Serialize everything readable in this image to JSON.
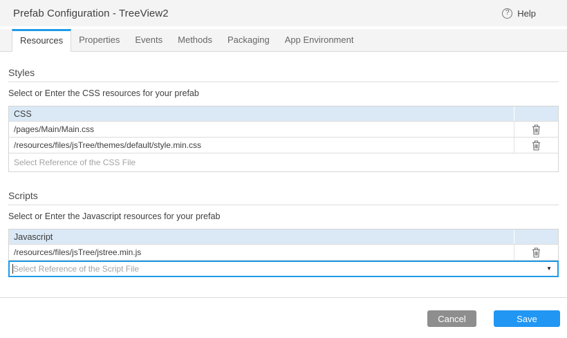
{
  "colors": {
    "accent": "#1d9be9",
    "table-header-bg": "#dbe9f6",
    "save-bg": "#2196f3",
    "cancel-bg": "#8e8e8e"
  },
  "icons": {
    "help": "?",
    "dropdown": "▼"
  },
  "header": {
    "title": "Prefab Configuration - TreeView2",
    "help": "Help"
  },
  "tabs": [
    {
      "label": "Resources",
      "active": true
    },
    {
      "label": "Properties",
      "active": false
    },
    {
      "label": "Events",
      "active": false
    },
    {
      "label": "Methods",
      "active": false
    },
    {
      "label": "Packaging",
      "active": false
    },
    {
      "label": "App Environment",
      "active": false
    }
  ],
  "styles_section": {
    "title": "Styles",
    "description": "Select or Enter the CSS resources for your prefab",
    "column_header": "CSS",
    "rows": [
      "/pages/Main/Main.css",
      "/resources/files/jsTree/themes/default/style.min.css"
    ],
    "placeholder": "Select Reference of the CSS File"
  },
  "scripts_section": {
    "title": "Scripts",
    "description": "Select or Enter the Javascript resources for your prefab",
    "column_header": "Javascript",
    "rows": [
      "/resources/files/jsTree/jstree.min.js"
    ],
    "placeholder": "Select Reference of the Script File"
  },
  "footer": {
    "cancel": "Cancel",
    "save": "Save"
  }
}
